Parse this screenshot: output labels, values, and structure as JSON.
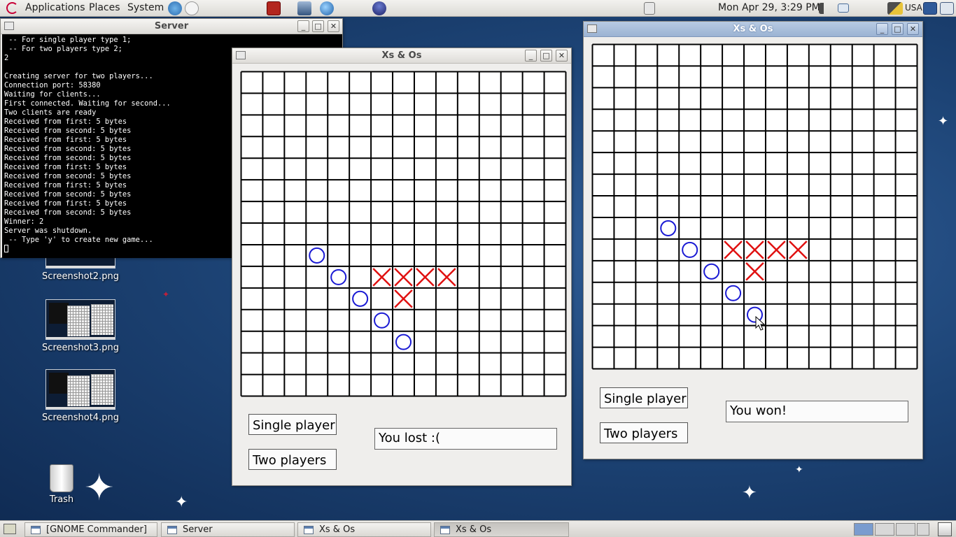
{
  "colors": {
    "o_mark": "#1a1ad4",
    "x_mark": "#e01010",
    "grid": "#000000"
  },
  "top_panel": {
    "menus": [
      "Applications",
      "Places",
      "System"
    ],
    "clock": "Mon Apr 29,  3:29 PM",
    "keyboard_layout": "USA",
    "launcher_icons": [
      "help-icon",
      "mail-icon",
      "terminal-launcher-icon",
      "sysmon-icon",
      "browser-icon",
      "eclipse-icon"
    ]
  },
  "desktop_icons": [
    {
      "label": "Screenshot2.png"
    },
    {
      "label": "Screenshot3.png"
    },
    {
      "label": "Screenshot4.png"
    },
    {
      "label": "Trash"
    }
  ],
  "server_window": {
    "title": "Server",
    "lines": [
      " -- For single player type 1;",
      " -- For two players type 2;",
      "2",
      "",
      "Creating server for two players...",
      "Connection port: 58380",
      "Waiting for clients...",
      "First connected. Waiting for second...",
      "Two clients are ready",
      "Received from first: 5 bytes",
      "Received from second: 5 bytes",
      "Received from first: 5 bytes",
      "Received from second: 5 bytes",
      "Received from second: 5 bytes",
      "Received from first: 5 bytes",
      "Received from second: 5 bytes",
      "Received from first: 5 bytes",
      "Received from second: 5 bytes",
      "Received from first: 5 bytes",
      "Received from second: 5 bytes",
      "Winner: 2",
      "Server was shutdown.",
      " -- Type 'y' to create new game..."
    ]
  },
  "game_windows": [
    {
      "title": "Xs & Os",
      "grid_size": 15,
      "o_marks": [
        [
          3,
          8
        ],
        [
          4,
          9
        ],
        [
          5,
          10
        ],
        [
          6,
          11
        ],
        [
          7,
          12
        ]
      ],
      "x_marks": [
        [
          6,
          9
        ],
        [
          7,
          9
        ],
        [
          8,
          9
        ],
        [
          9,
          9
        ],
        [
          7,
          10
        ]
      ],
      "single_player_label": "Single player",
      "two_players_label": "Two players",
      "status": "You lost :("
    },
    {
      "title": "Xs & Os",
      "grid_size": 15,
      "o_marks": [
        [
          3,
          8
        ],
        [
          4,
          9
        ],
        [
          5,
          10
        ],
        [
          6,
          11
        ],
        [
          7,
          12
        ]
      ],
      "x_marks": [
        [
          6,
          9
        ],
        [
          7,
          9
        ],
        [
          8,
          9
        ],
        [
          9,
          9
        ],
        [
          7,
          10
        ]
      ],
      "single_player_label": "Single player",
      "two_players_label": "Two players",
      "status": "You won!"
    }
  ],
  "taskbar": {
    "tasks": [
      "[GNOME Commander]",
      "Server",
      "Xs & Os",
      "Xs & Os"
    ]
  }
}
